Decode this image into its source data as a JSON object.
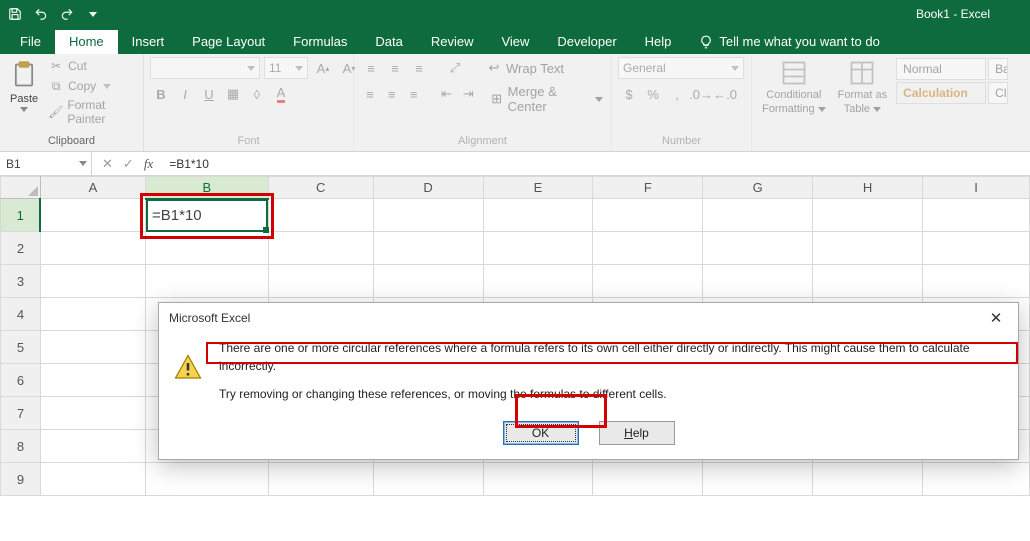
{
  "titlebar": {
    "title": "Book1 - Excel"
  },
  "tabs": {
    "file": "File",
    "home": "Home",
    "insert": "Insert",
    "pagelayout": "Page Layout",
    "formulas": "Formulas",
    "data": "Data",
    "review": "Review",
    "view": "View",
    "developer": "Developer",
    "help": "Help",
    "tellme": "Tell me what you want to do"
  },
  "ribbon": {
    "clipboard": {
      "paste": "Paste",
      "cut": "Cut",
      "copy": "Copy",
      "fmtpainter": "Format Painter",
      "label": "Clipboard"
    },
    "font": {
      "size": "11",
      "label": "Font",
      "btns": {
        "bold": "B",
        "italic": "I",
        "underline": "U"
      }
    },
    "alignment": {
      "wrap": "Wrap Text",
      "merge": "Merge & Center",
      "label": "Alignment"
    },
    "number": {
      "format": "General",
      "label": "Number"
    },
    "styles": {
      "cond": "Conditional",
      "cond2": "Formatting",
      "fmt": "Format as",
      "fmt2": "Table",
      "normal": "Normal",
      "bad": "Ba",
      "calc": "Calculation",
      "ch": "Cl"
    },
    "tri": "▾"
  },
  "namebox": "B1",
  "formula": "=B1*10",
  "columns": [
    "A",
    "B",
    "C",
    "D",
    "E",
    "F",
    "G",
    "H",
    "I"
  ],
  "rows": [
    "1",
    "2",
    "3",
    "4",
    "5",
    "6",
    "7",
    "8",
    "9"
  ],
  "cellB1": "=B1*10",
  "dialog": {
    "title": "Microsoft Excel",
    "line1": "There are one or more circular references where a formula refers to its own cell either directly or indirectly. This might cause them to calculate incorrectly.",
    "line2": "Try removing or changing these references, or moving the formulas to different cells.",
    "ok": "OK",
    "help_h": "H",
    "help_rest": "elp"
  }
}
